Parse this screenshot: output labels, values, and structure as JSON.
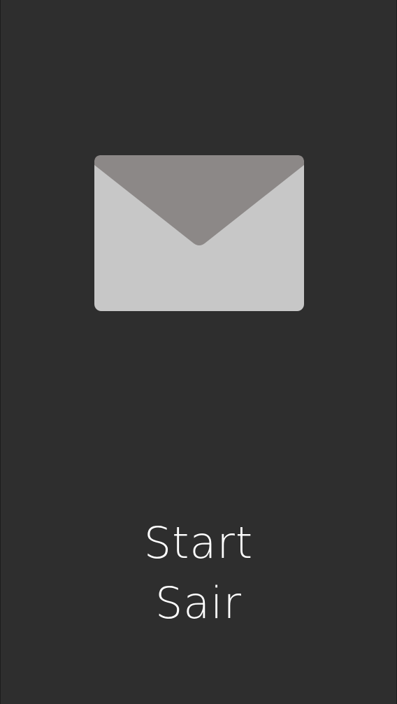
{
  "icon": {
    "name": "envelope-icon",
    "body_color": "#c7c7c7",
    "flap_color": "#8c8887"
  },
  "menu": {
    "items": [
      {
        "id": "start",
        "label": "Start"
      },
      {
        "id": "exit",
        "label": "Sair"
      }
    ]
  },
  "theme": {
    "background": "#2e2e2e",
    "text_color": "#ffffff"
  }
}
